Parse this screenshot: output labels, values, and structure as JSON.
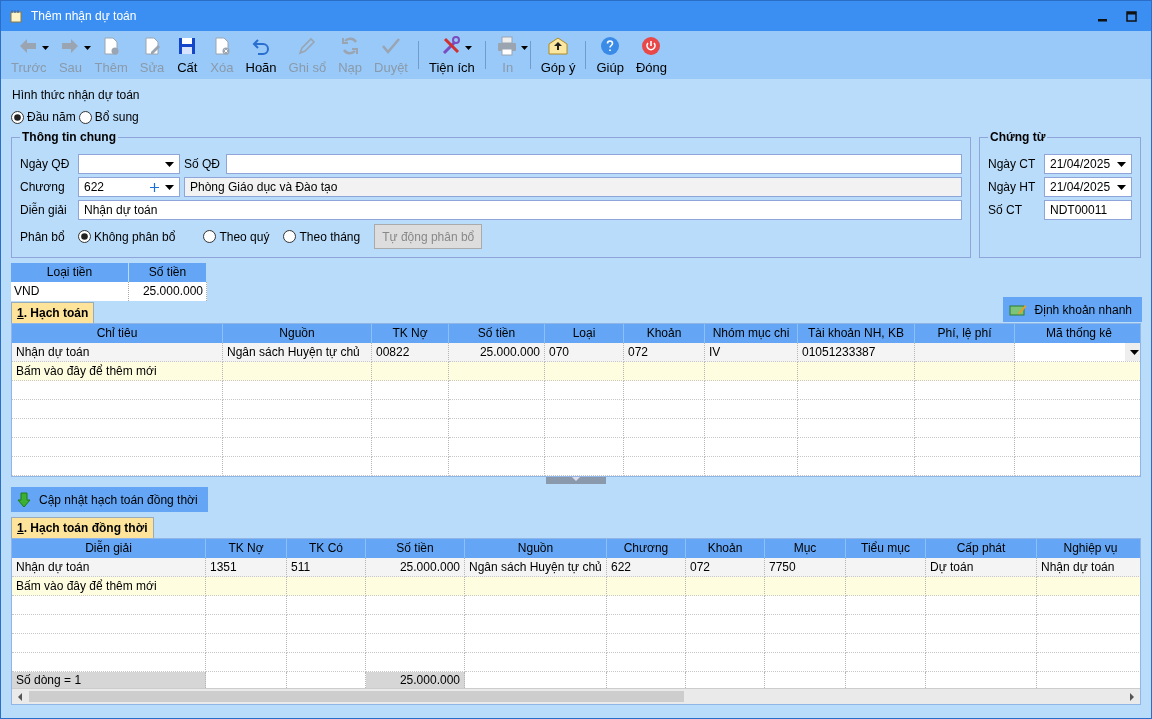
{
  "window": {
    "title": "Thêm nhận dự toán"
  },
  "toolbar": {
    "groups": [
      [
        {
          "label": "Trước",
          "disabled": true,
          "dropdown": true
        },
        {
          "label": "Sau",
          "disabled": true,
          "dropdown": true
        },
        {
          "label": "Thêm",
          "disabled": true,
          "dropdown": false
        },
        {
          "label": "Sửa",
          "disabled": true,
          "dropdown": false
        },
        {
          "label": "Cất",
          "disabled": false,
          "dropdown": false
        },
        {
          "label": "Xóa",
          "disabled": true,
          "dropdown": false
        },
        {
          "label": "Hoãn",
          "disabled": false,
          "dropdown": false
        },
        {
          "label": "Ghi sổ",
          "disabled": true,
          "dropdown": false
        },
        {
          "label": "Nạp",
          "disabled": true,
          "dropdown": false
        },
        {
          "label": "Duyệt",
          "disabled": true,
          "dropdown": false
        }
      ],
      [
        {
          "label": "Tiện ích",
          "disabled": false,
          "dropdown": true
        }
      ],
      [
        {
          "label": "In",
          "disabled": true,
          "dropdown": true
        }
      ],
      [
        {
          "label": "Góp ý",
          "disabled": false,
          "dropdown": false
        }
      ],
      [
        {
          "label": "Giúp",
          "disabled": false,
          "dropdown": false
        },
        {
          "label": "Đóng",
          "disabled": false,
          "dropdown": false
        }
      ]
    ]
  },
  "receive_type": {
    "label": "Hình thức nhận dự toán",
    "options": [
      {
        "label": "Đầu năm",
        "selected": true
      },
      {
        "label": "Bổ sung",
        "selected": false
      }
    ]
  },
  "general_info": {
    "title": "Thông tin chung",
    "ngay_qd": {
      "label": "Ngày QĐ"
    },
    "so_qd": {
      "label": "Số QĐ"
    },
    "chuong": {
      "label": "Chương",
      "value": "622",
      "name": "Phòng Giáo dục và Đào tạo"
    },
    "dien_giai": {
      "label": "Diễn giải",
      "value": "Nhận dự toán"
    },
    "phan_bo": {
      "label": "Phân bổ",
      "options": [
        {
          "label": "Không phân bổ",
          "selected": true
        },
        {
          "label": "Theo quý",
          "selected": false
        },
        {
          "label": "Theo tháng",
          "selected": false
        }
      ],
      "auto_button": {
        "label": "Tự động phân bổ",
        "disabled": true
      }
    }
  },
  "voucher": {
    "title": "Chứng từ",
    "fields": [
      {
        "label": "Ngày CT",
        "value": "21/04/2025",
        "kind": "date"
      },
      {
        "label": "Ngày HT",
        "value": "21/04/2025",
        "kind": "date"
      },
      {
        "label": "Số CT",
        "value": "NDT00011",
        "kind": "text"
      }
    ]
  },
  "currency_table": {
    "columns": [
      "Loại tiền",
      "Số tiền"
    ],
    "rows": [
      [
        "VND",
        "25.000.000"
      ]
    ]
  },
  "quick_entry_button": {
    "label": "Định khoản nhanh"
  },
  "accounting": {
    "tab": {
      "label": "1. Hạch toán",
      "selected": true
    },
    "columns": [
      {
        "label": "Chỉ tiêu",
        "kind": "text"
      },
      {
        "label": "Nguồn",
        "kind": "text"
      },
      {
        "label": "TK Nợ",
        "kind": "text"
      },
      {
        "label": "Số tiền",
        "kind": "number"
      },
      {
        "label": "Loại",
        "kind": "text"
      },
      {
        "label": "Khoản",
        "kind": "text"
      },
      {
        "label": "Nhóm mục chi",
        "kind": "text"
      },
      {
        "label": "Tài khoản NH, KB",
        "kind": "text"
      },
      {
        "label": "Phí, lệ phí",
        "kind": "text"
      },
      {
        "label": "Mã thống kê",
        "kind": "dropdown"
      }
    ],
    "rows": [
      [
        "Nhận dự toán",
        "Ngân sách Huyện tự chủ",
        "00822",
        "25.000.000",
        "070",
        "072",
        "IV",
        "01051233387",
        null,
        null
      ]
    ],
    "new_row_hint": "Bấm vào đây để thêm mới"
  },
  "update_button": {
    "label": "Cập nhật hạch toán đồng thời"
  },
  "concurrent": {
    "tab": {
      "label": "1. Hạch toán đồng thời",
      "selected": true
    },
    "columns": [
      {
        "label": "Diễn giải",
        "kind": "text"
      },
      {
        "label": "TK Nợ",
        "kind": "text"
      },
      {
        "label": "TK Có",
        "kind": "text"
      },
      {
        "label": "Số tiền",
        "kind": "number"
      },
      {
        "label": "Nguồn",
        "kind": "text"
      },
      {
        "label": "Chương",
        "kind": "text"
      },
      {
        "label": "Khoản",
        "kind": "text"
      },
      {
        "label": "Mục",
        "kind": "text"
      },
      {
        "label": "Tiểu mục",
        "kind": "text"
      },
      {
        "label": "Cấp phát",
        "kind": "text"
      },
      {
        "label": "Nghiệp vụ",
        "kind": "text"
      }
    ],
    "rows": [
      [
        "Nhận dự toán",
        "1351",
        "511",
        "25.000.000",
        "Ngân sách Huyện tự chủ",
        "622",
        "072",
        "7750",
        null,
        "Dự toán",
        "Nhận dự toán"
      ]
    ],
    "new_row_hint": "Bấm vào đây để thêm mới",
    "footer": {
      "count": "Số dòng = 1",
      "total": "25.000.000"
    }
  }
}
